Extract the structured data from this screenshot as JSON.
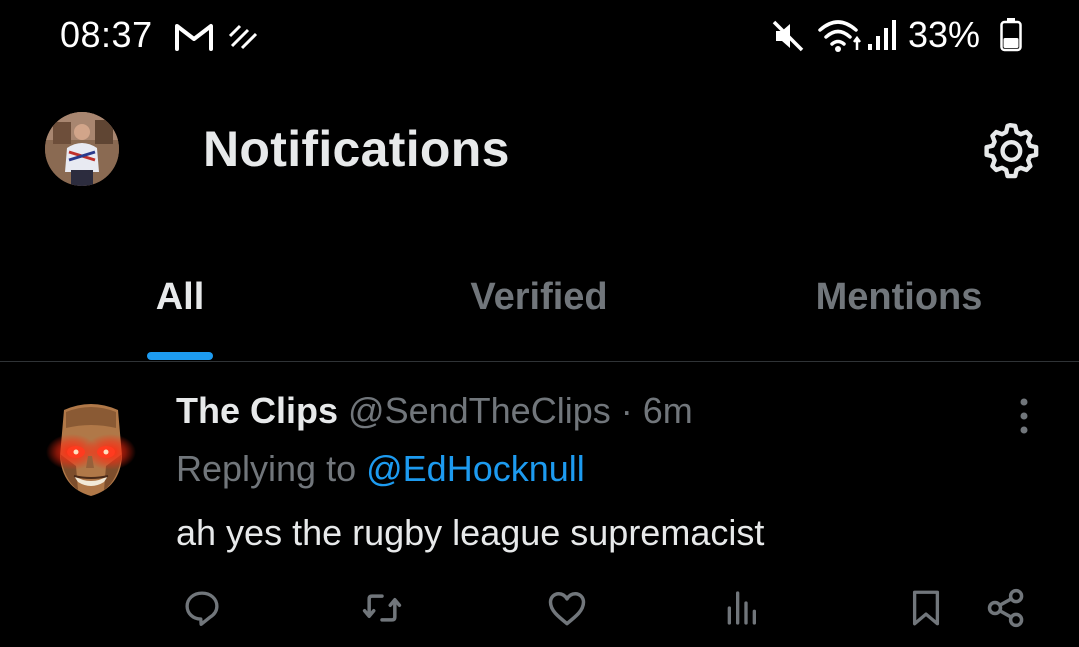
{
  "status_bar": {
    "time": "08:37",
    "battery": "33%",
    "icons": [
      "gmail-icon",
      "activity-icon",
      "mute-icon",
      "wifi-icon",
      "signal-icon",
      "battery-icon"
    ]
  },
  "header": {
    "title": "Notifications",
    "avatar_icon": "profile-avatar",
    "settings_icon": "gear-icon"
  },
  "tabs": [
    {
      "label": "All",
      "active": true
    },
    {
      "label": "Verified",
      "active": false
    },
    {
      "label": "Mentions",
      "active": false
    }
  ],
  "tweet": {
    "author": "The Clips",
    "handle": "@SendTheClips",
    "separator": "·",
    "time": "6m",
    "replying_prefix": "Replying to",
    "replying_to": "@EdHocknull",
    "text": "ah yes the rugby league supremacist",
    "actions": [
      "reply-icon",
      "retweet-icon",
      "like-icon",
      "views-icon",
      "bookmark-icon",
      "share-icon"
    ]
  },
  "colors": {
    "background": "#000000",
    "text": "#e7e9ea",
    "muted": "#71767b",
    "accent": "#1d9bf0",
    "divider": "#2f3336"
  }
}
